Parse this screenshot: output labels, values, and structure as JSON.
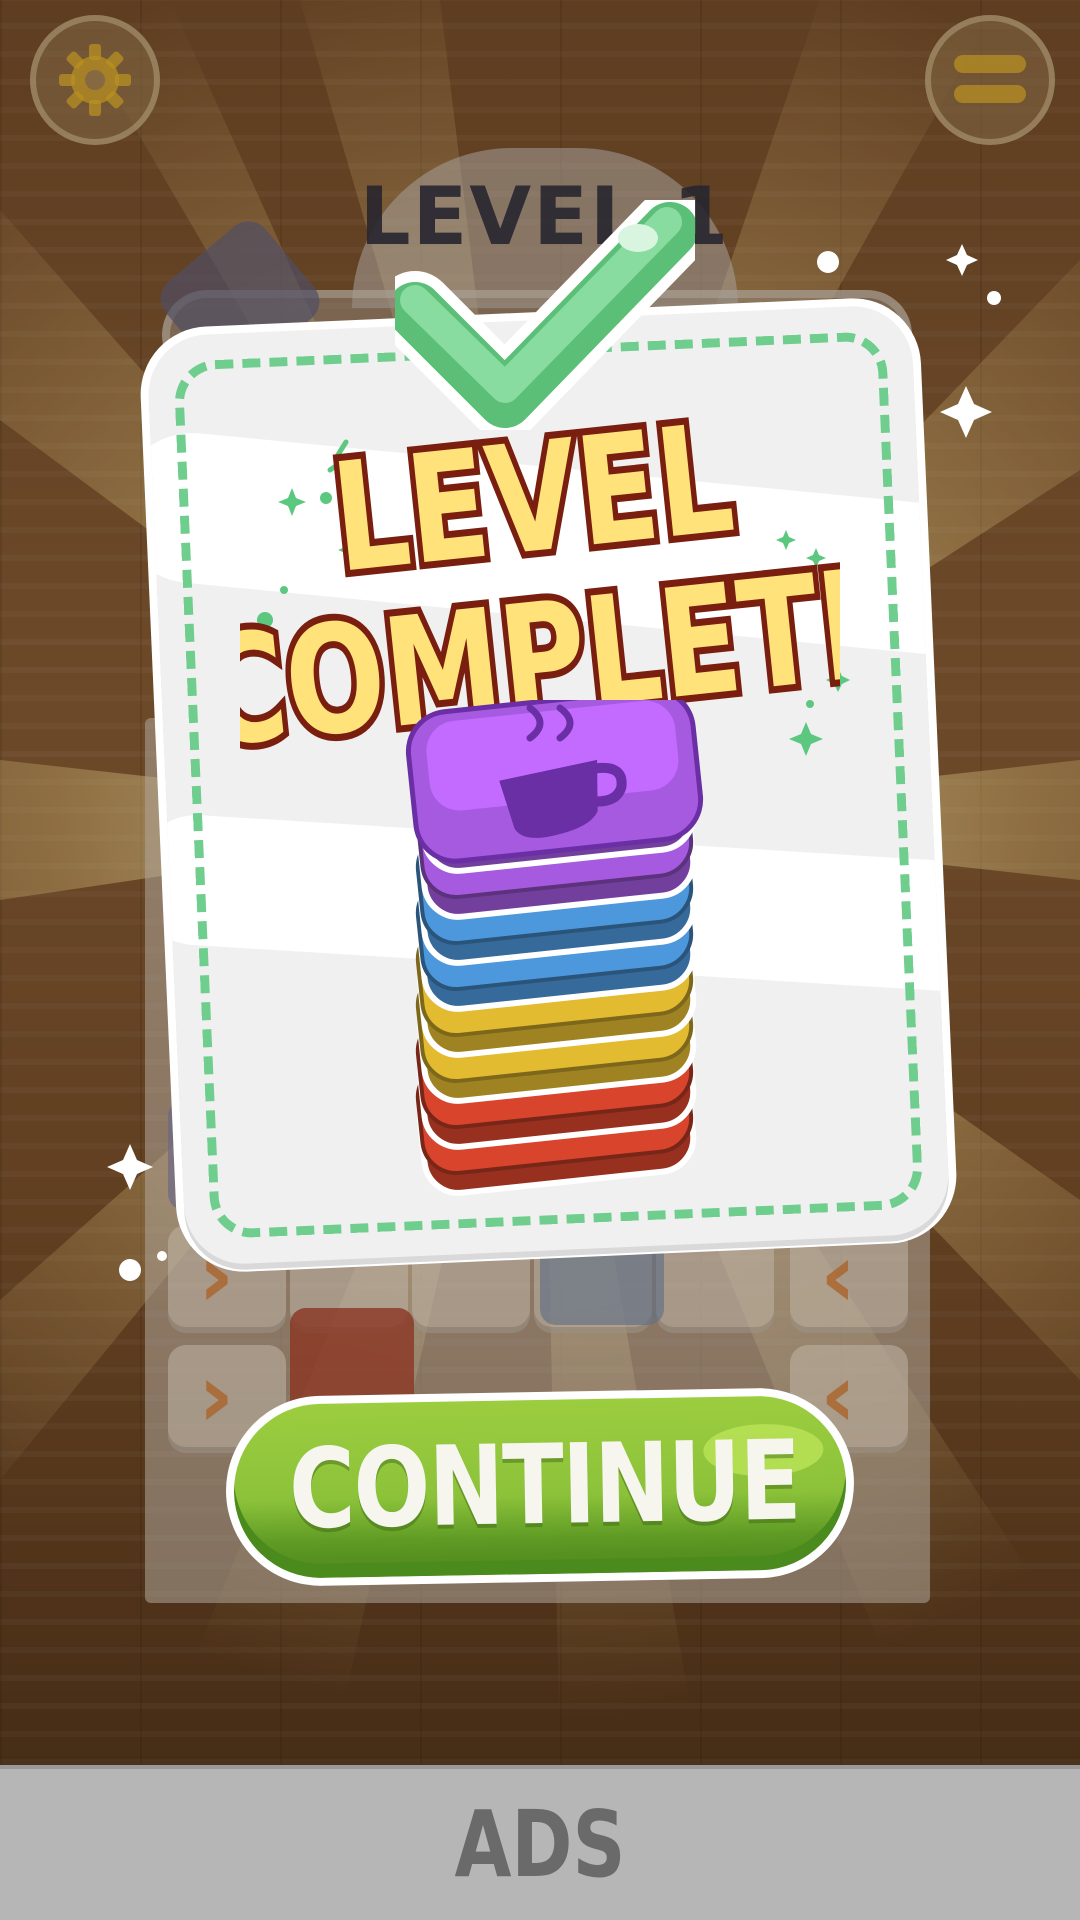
{
  "game": {
    "level_label": "LEVEL 1",
    "settings_icon": "gear-icon",
    "menu_icon": "menu-icon"
  },
  "popup": {
    "title_line1": "LEVEL",
    "title_line2": "COMPLETE",
    "check_icon": "checkmark-icon",
    "stack_icon": "coffee-cup-icon",
    "stack_colors": [
      "#a55ae0",
      "#a55ae0",
      "#4d98dd",
      "#4d98dd",
      "#e3bb31",
      "#e3bb31",
      "#d8452c",
      "#d8452c"
    ]
  },
  "continue_button": {
    "label": "CONTINUE"
  },
  "ads": {
    "label": "ADS"
  },
  "colors": {
    "accent_green": "#8cc23a",
    "dash_green": "#6fce8e",
    "title_fill": "#ffe27a",
    "title_outline": "#7a1f10"
  }
}
